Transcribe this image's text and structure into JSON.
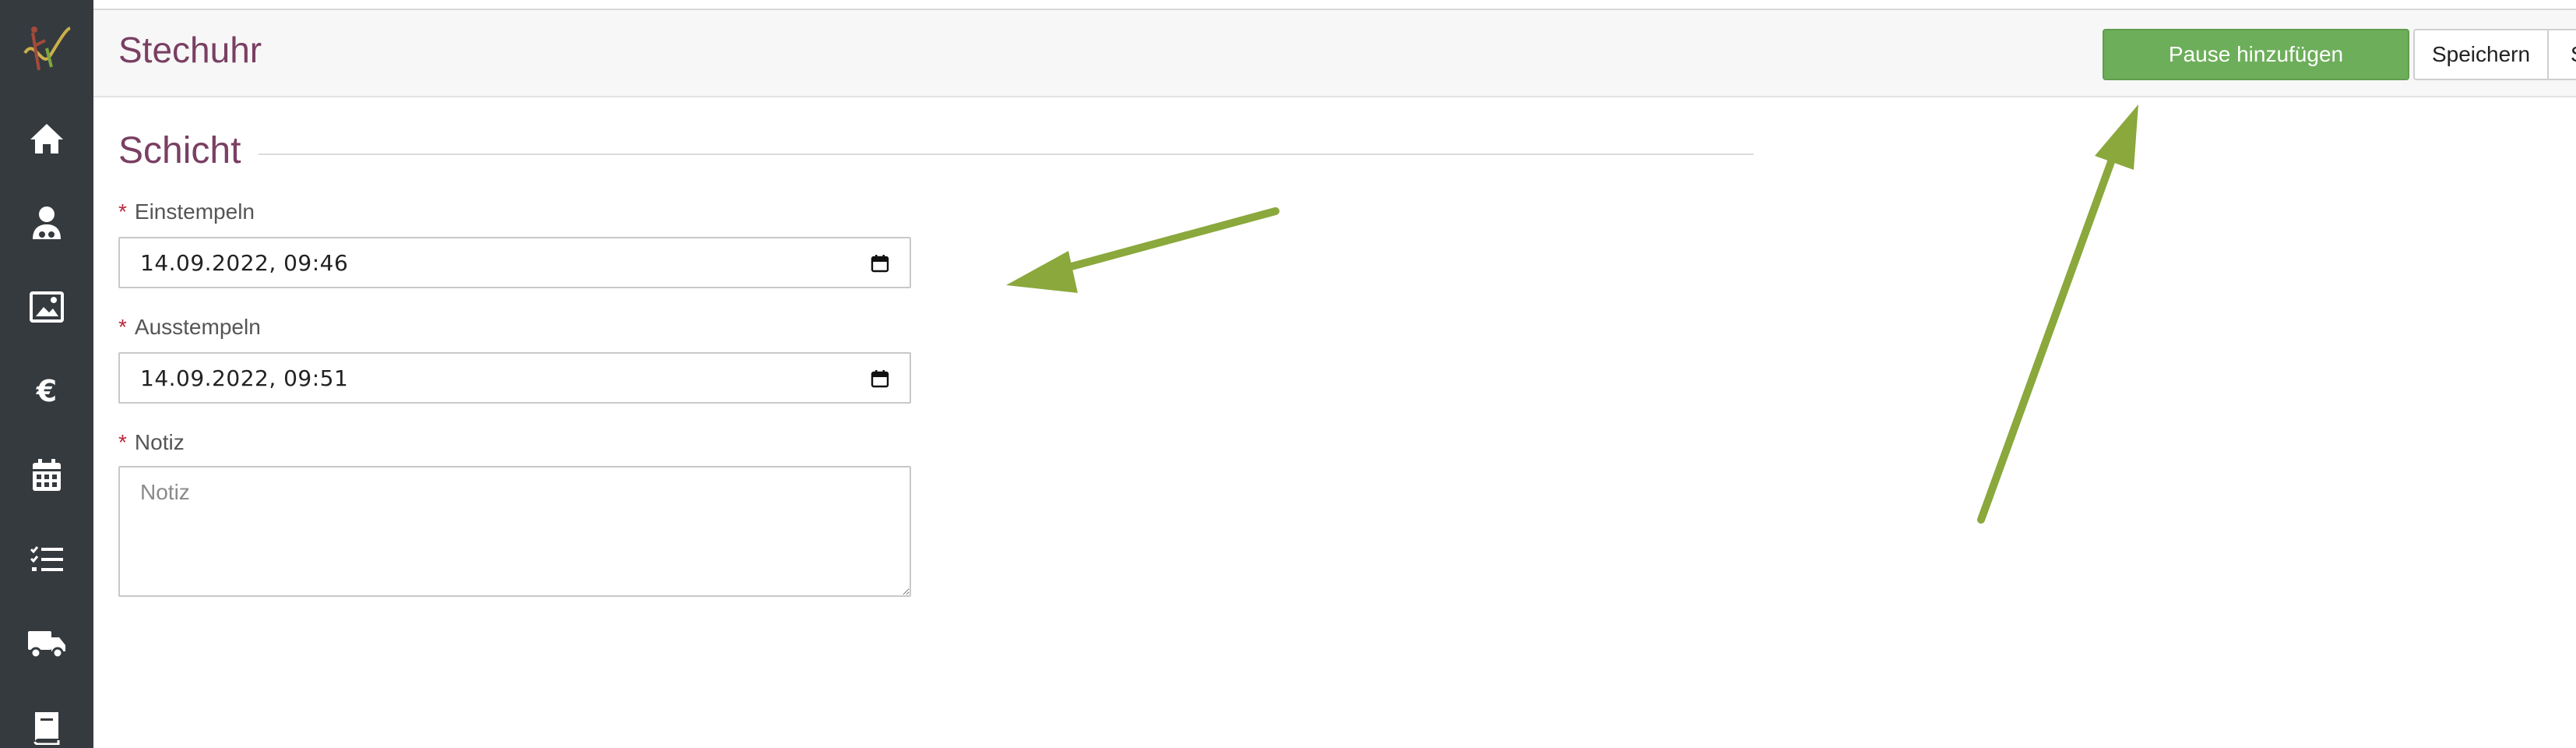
{
  "app": {
    "page_title": "Stechuhr",
    "brand_color": "#7a3f63",
    "accent_color": "#6dae5a"
  },
  "sidebar": {
    "logo": "app-logo",
    "items": [
      {
        "icon": "home-icon"
      },
      {
        "icon": "user-icon"
      },
      {
        "icon": "image-icon"
      },
      {
        "icon": "euro-icon"
      },
      {
        "icon": "calendar-icon"
      },
      {
        "icon": "checklist-icon"
      },
      {
        "icon": "truck-icon"
      },
      {
        "icon": "book-icon"
      }
    ]
  },
  "toolbar": {
    "pause_label": "Pause hinzufügen",
    "save_label": "Speichern",
    "close_label": "Schließen"
  },
  "form": {
    "section_title": "Schicht",
    "required_marker": "*",
    "clock_in": {
      "label": "Einstempeln",
      "value": "14.09.2022, 09:46"
    },
    "clock_out": {
      "label": "Ausstempeln",
      "value": "14.09.2022, 09:51"
    },
    "note": {
      "label": "Notiz",
      "value": "",
      "placeholder": "Notiz"
    }
  },
  "annotations": {
    "arrow_color": "#8aa83c"
  }
}
